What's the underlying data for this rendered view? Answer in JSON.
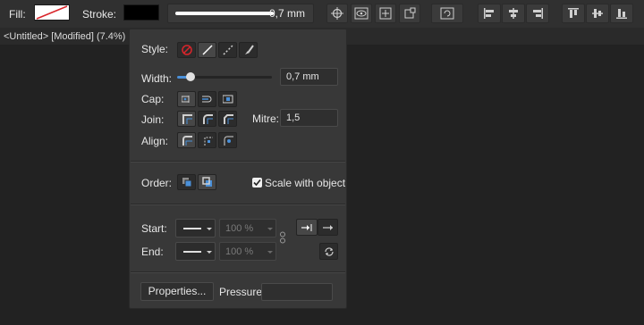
{
  "toolbar": {
    "fill_label": "Fill:",
    "stroke_label": "Stroke:",
    "width_value": "0,7 mm",
    "fill_color": "#ffffff",
    "fill_none_color": "#d9252b",
    "stroke_color": "#000000"
  },
  "document": {
    "title": "<Untitled> [Modified] (7.4%)"
  },
  "stroke_panel": {
    "style_label": "Style:",
    "width_label": "Width:",
    "width_value": "0,7 mm",
    "width_fraction": 0.14,
    "cap_label": "Cap:",
    "join_label": "Join:",
    "mitre_label": "Mitre:",
    "mitre_value": "1,5",
    "align_label": "Align:",
    "order_label": "Order:",
    "scale_label": "Scale with object",
    "scale_checked": true,
    "start_label": "Start:",
    "end_label": "End:",
    "start_scale": "100 %",
    "end_scale": "100 %",
    "properties_label": "Properties...",
    "pressure_label": "Pressure:"
  },
  "accent_color": "#4a90d9"
}
